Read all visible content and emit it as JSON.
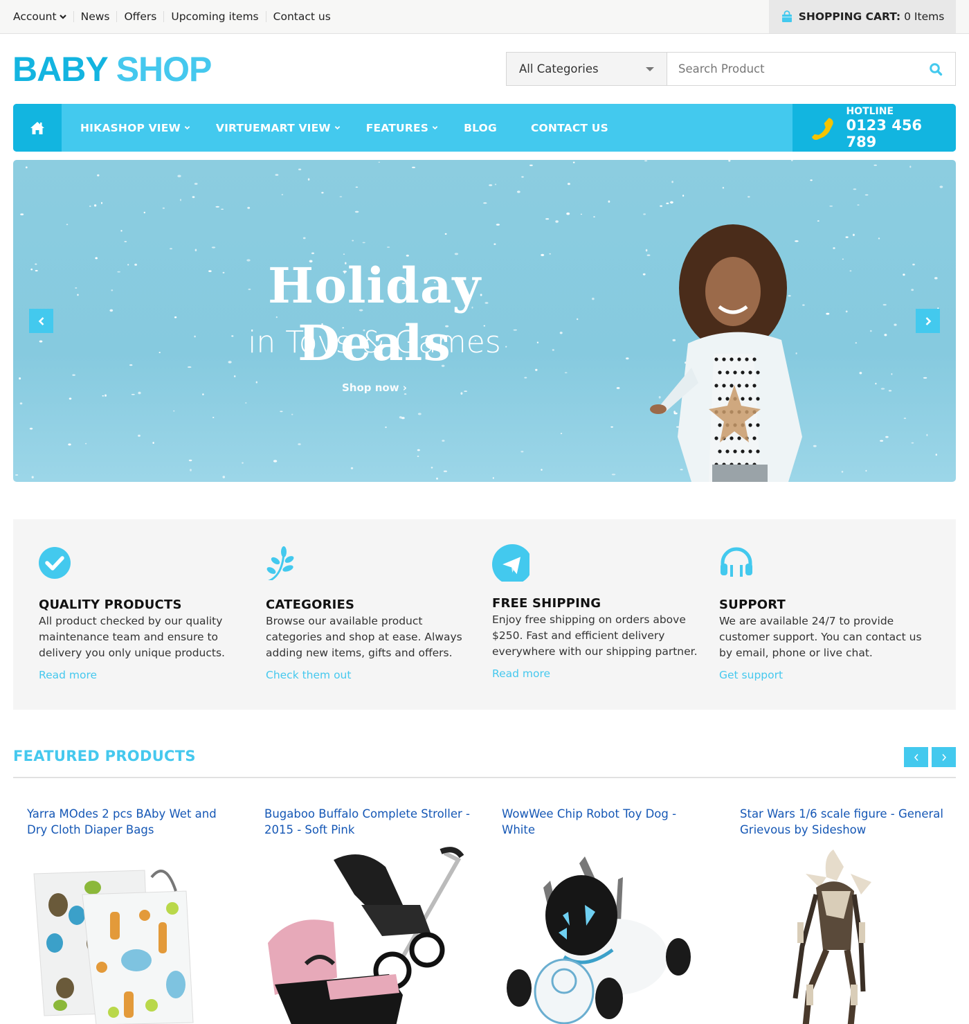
{
  "topbar": {
    "links": [
      {
        "label": "Account",
        "has_dropdown": true
      },
      {
        "label": "News"
      },
      {
        "label": "Offers"
      },
      {
        "label": "Upcoming items"
      },
      {
        "label": "Contact us"
      }
    ],
    "cart": {
      "label": "SHOPPING CART:",
      "count_text": "0 Items",
      "icon": "shopping-bag-icon"
    }
  },
  "header": {
    "logo_part1": "BABY",
    "logo_part2": "SHOP",
    "search": {
      "category_selected": "All Categories",
      "placeholder": "Search Product",
      "value": "",
      "icon": "search-icon"
    }
  },
  "mainnav": {
    "home_icon": "home-icon",
    "items": [
      {
        "label": "HIKASHOP VIEW",
        "has_dropdown": true
      },
      {
        "label": "VIRTUEMART VIEW",
        "has_dropdown": true
      },
      {
        "label": "FEATURES",
        "has_dropdown": true
      },
      {
        "label": "BLOG",
        "has_dropdown": false
      },
      {
        "label": "CONTACT US",
        "has_dropdown": false
      }
    ],
    "hotline": {
      "label": "HOTLINE",
      "number": "0123 456 789",
      "icon": "phone-icon"
    }
  },
  "slider": {
    "title": "Holiday Deals",
    "subtitle": "in Toys & Games",
    "cta": "Shop now ›",
    "prev_icon": "chevron-left-icon",
    "next_icon": "chevron-right-icon"
  },
  "features": [
    {
      "icon": "check-circle-icon",
      "title": "QUALITY PRODUCTS",
      "text": "All product checked by our quality maintenance team and ensure to delivery you only unique products.",
      "link": "Read more"
    },
    {
      "icon": "leaf-icon",
      "title": "CATEGORIES",
      "text": "Browse our available product categories and shop at ease. Always adding new items, gifts and offers.",
      "link": "Check them out"
    },
    {
      "icon": "paper-plane-icon",
      "title": "FREE SHIPPING",
      "text": "Enjoy free shipping on orders above $250. Fast and efficient delivery everywhere with our shipping partner.",
      "link": "Read more"
    },
    {
      "icon": "headphones-icon",
      "title": "SUPPORT",
      "text": "We are available 24/7 to provide customer support. You can contact us by email, phone or live chat.",
      "link": "Get support"
    }
  ],
  "featured": {
    "title": "FEATURED PRODUCTS",
    "products": [
      {
        "name": "Yarra MOdes 2 pcs BAby Wet and Dry Cloth Diaper Bags",
        "image": "diaper-bags-image"
      },
      {
        "name": "Bugaboo Buffalo Complete Stroller - 2015 - Soft Pink",
        "image": "stroller-image"
      },
      {
        "name": "WowWee Chip Robot Toy Dog - White",
        "image": "robot-dog-image"
      },
      {
        "name": "Star Wars 1/6 scale figure - General Grievous by Sideshow",
        "image": "action-figure-image"
      }
    ]
  },
  "colors": {
    "accent": "#43c9ee",
    "accent_dark": "#12b5e0",
    "link": "#1557b5",
    "hotline_icon": "#f5c400"
  }
}
